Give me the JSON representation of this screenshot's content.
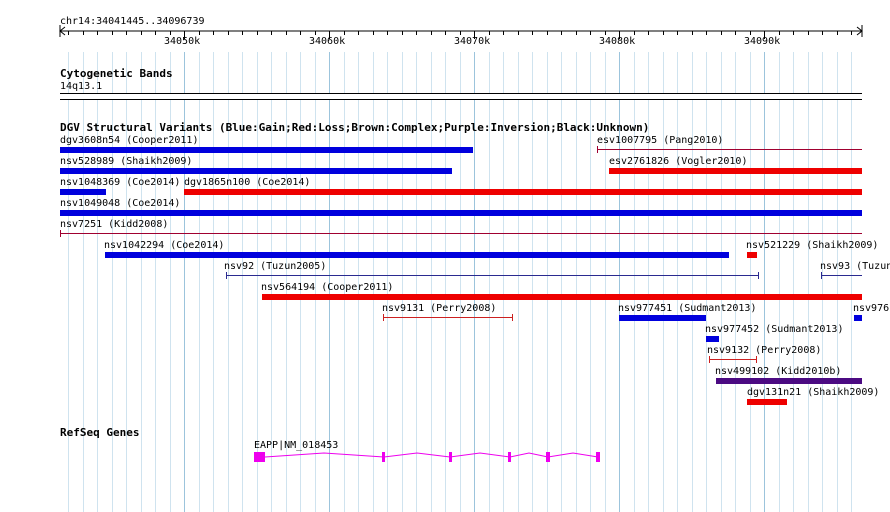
{
  "ruler": {
    "location": "chr14:34041445..34096739",
    "ticks": [
      "34050k",
      "34060k",
      "34070k",
      "34080k",
      "34090k"
    ]
  },
  "tracks": {
    "cytoband": {
      "title": "Cytogenetic Bands",
      "band": "14q13.1"
    },
    "dgv": {
      "title": "DGV Structural Variants (Blue:Gain;Red:Loss;Brown:Complex;Purple:Inversion;Black:Unknown)",
      "features": [
        {
          "label": "dgv3608n54 (Cooper2011)",
          "color": "#0000dd",
          "style": "thick"
        },
        {
          "label": "esv1007795 (Pang2010)",
          "color": "#a00030",
          "style": "thin"
        },
        {
          "label": "nsv528989 (Shaikh2009)",
          "color": "#0000dd",
          "style": "thick"
        },
        {
          "label": "esv2761826 (Vogler2010)",
          "color": "#ee0000",
          "style": "thick"
        },
        {
          "label": "nsv1048369 (Coe2014)",
          "color": "#0000dd",
          "style": "thick"
        },
        {
          "label": "dgv1865n100 (Coe2014)",
          "color": "#ee0000",
          "style": "thick"
        },
        {
          "label": "nsv1049048 (Coe2014)",
          "color": "#0000dd",
          "style": "thick"
        },
        {
          "label": "nsv7251 (Kidd2008)",
          "color": "#a00030",
          "style": "thin"
        },
        {
          "label": "nsv1042294 (Coe2014)",
          "color": "#0000dd",
          "style": "thick"
        },
        {
          "label": "nsv521229 (Shaikh2009)",
          "color": "#ee0000",
          "style": "thick"
        },
        {
          "label": "nsv92 (Tuzun2005)",
          "color": "#2a2a90",
          "style": "thin"
        },
        {
          "label": "nsv93 (Tuzun",
          "color": "#2a2a90",
          "style": "thin"
        },
        {
          "label": "nsv564194 (Cooper2011)",
          "color": "#ee0000",
          "style": "thick"
        },
        {
          "label": "nsv9131 (Perry2008)",
          "color": "#cc2020",
          "style": "thin"
        },
        {
          "label": "nsv977451 (Sudmant2013)",
          "color": "#0000dd",
          "style": "thick"
        },
        {
          "label": "nsv976",
          "color": "#0000dd",
          "style": "thick"
        },
        {
          "label": "nsv977452 (Sudmant2013)",
          "color": "#0000dd",
          "style": "thick"
        },
        {
          "label": "nsv9132 (Perry2008)",
          "color": "#cc2020",
          "style": "thin"
        },
        {
          "label": "nsv499102 (Kidd2010b)",
          "color": "#4b0a82",
          "style": "thick"
        },
        {
          "label": "dgv131n21 (Shaikh2009)",
          "color": "#ee0000",
          "style": "thick"
        }
      ]
    },
    "refseq": {
      "title": "RefSeq Genes",
      "gene": {
        "label": "EAPP|NM_018453",
        "color": "#ee00ee"
      }
    }
  }
}
